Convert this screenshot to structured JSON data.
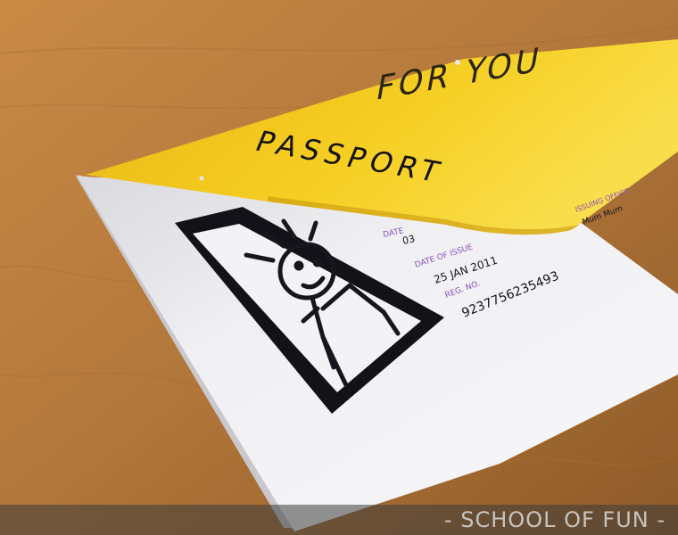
{
  "cover": {
    "top_text": "FOR YOU",
    "title": "PASSPORT"
  },
  "page": {
    "field_label_1": "DATE",
    "field_value_1": "03",
    "field_label_2": "DATE OF ISSUE",
    "field_value_2": "25 JAN 2011",
    "field_label_3": "REG. NO.",
    "field_value_3": "9237756235493",
    "side_label": "ISSUING OFFICE",
    "side_value": "Mum Mum"
  },
  "watermark": {
    "text": "- SCHOOL OF FUN -"
  },
  "colors": {
    "table": "#b47a3a",
    "cover_yellow": "#f2c21a",
    "paper": "#f2f2f4",
    "ink": "#14141e",
    "label_purple": "#8a4fbf"
  },
  "icons": [
    "stick-figure-icon"
  ]
}
